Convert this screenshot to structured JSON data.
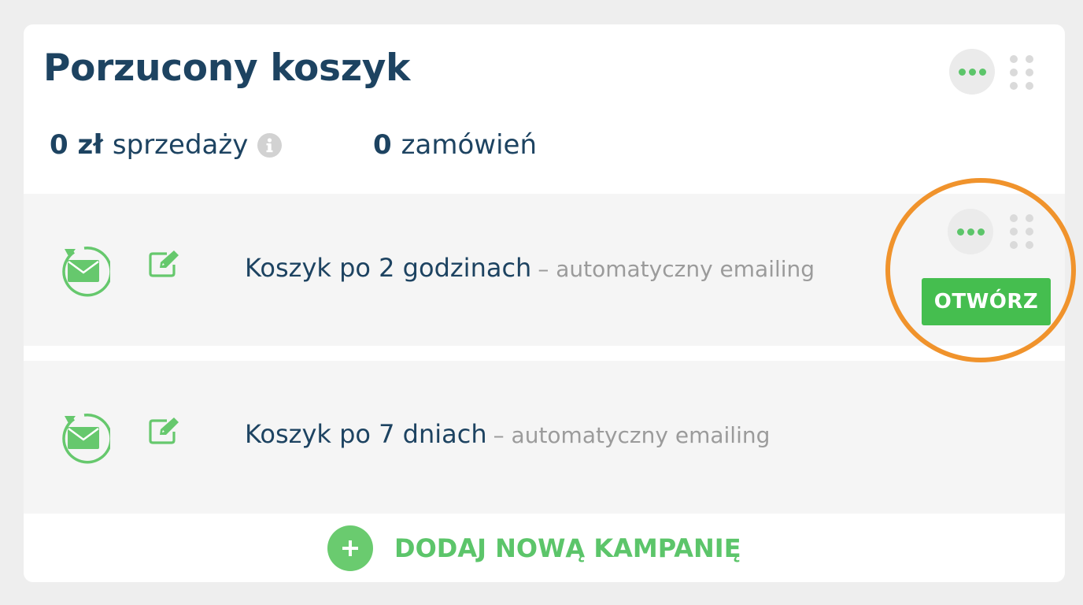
{
  "widget": {
    "title": "Porzucony koszyk",
    "stats": {
      "sales_value": "0 zł",
      "sales_label": "sprzedaży",
      "orders_value": "0",
      "orders_label": "zamówień"
    }
  },
  "campaigns": [
    {
      "name": "Koszyk po 2 godzinach",
      "type": "– automatyczny emailing",
      "open_label": "OTWÓRZ"
    },
    {
      "name": "Koszyk po 7 dniach",
      "type": "– automatyczny emailing"
    }
  ],
  "add_campaign_label": "DODAJ NOWĄ KAMPANIĘ",
  "icons": {
    "more": "more-dots-icon",
    "drag": "drag-handle-icon",
    "info": "info-icon",
    "mail": "mail-refresh-icon",
    "edit": "edit-icon",
    "plus": "plus-icon"
  },
  "colors": {
    "accent": "#45be4f",
    "title": "#1d4361",
    "highlight": "#f0932c"
  }
}
